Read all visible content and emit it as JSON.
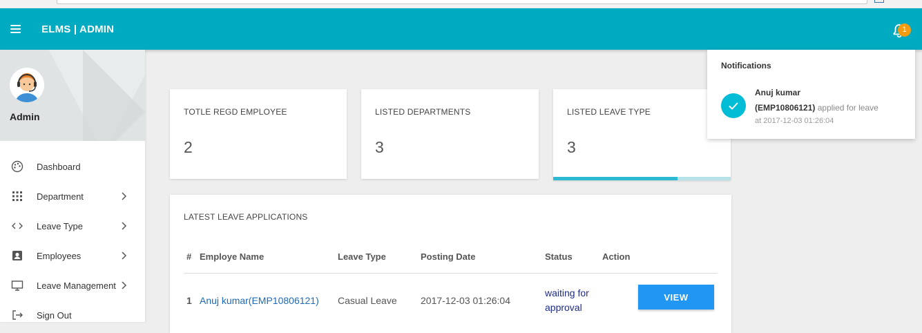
{
  "topbar": {
    "title": "ELMS | ADMIN",
    "notification_count": "1",
    "color": "#00aac1"
  },
  "sidebar": {
    "profile_name": "Admin",
    "items": [
      {
        "label": "Dashboard",
        "icon": "palette-icon",
        "has_chevron": false
      },
      {
        "label": "Department",
        "icon": "grid-icon",
        "has_chevron": true
      },
      {
        "label": "Leave Type",
        "icon": "code-icon",
        "has_chevron": true
      },
      {
        "label": "Employees",
        "icon": "account-box-icon",
        "has_chevron": true
      },
      {
        "label": "Leave Management",
        "icon": "monitor-icon",
        "has_chevron": true
      },
      {
        "label": "Sign Out",
        "icon": "exit-icon",
        "has_chevron": false
      }
    ]
  },
  "stats": [
    {
      "title": "TOTLE REGD EMPLOYEE",
      "value": "2"
    },
    {
      "title": "LISTED DEPARTMENTS",
      "value": "3"
    },
    {
      "title": "LISTED LEAVE TYPE",
      "value": "3",
      "progress": 0.7
    }
  ],
  "latest": {
    "title": "LATEST LEAVE APPLICATIONS",
    "columns": [
      "#",
      "Employe Name",
      "Leave Type",
      "Posting Date",
      "Status",
      "Action"
    ],
    "rows": [
      {
        "num": "1",
        "name": "Anuj kumar(EMP10806121)",
        "leave_type": "Casual Leave",
        "posting_date": "2017-12-03 01:26:04",
        "status_line1": "waiting for",
        "status_line2": "approval",
        "action": "VIEW"
      }
    ]
  },
  "notifications": {
    "title": "Notifications",
    "items": [
      {
        "name": "Anuj kumar",
        "emp_id": "(EMP10806121)",
        "message": "applied for leave",
        "time": "at 2017-12-03 01:26:04"
      }
    ]
  }
}
